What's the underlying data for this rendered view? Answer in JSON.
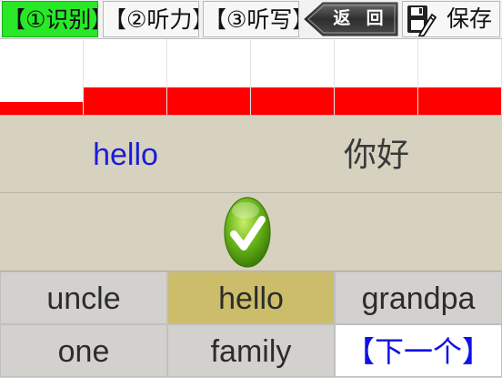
{
  "toolbar": {
    "tabs": [
      {
        "label": "【①识别】",
        "active": true
      },
      {
        "label": "【②听力】",
        "active": false
      },
      {
        "label": "【③听写】",
        "active": false
      }
    ],
    "back_label": "返 回",
    "save_label": "保存"
  },
  "progress": {
    "levels": [
      0.36,
      0.36,
      0.36,
      0.36,
      0.36,
      0.36
    ],
    "first_column_fill": 0.17,
    "fill_color": "#ff0000"
  },
  "word": {
    "english": "hello",
    "chinese": "你好"
  },
  "result": {
    "icon": "check-icon",
    "status": "correct"
  },
  "options": [
    {
      "label": "uncle",
      "highlighted": false
    },
    {
      "label": "hello",
      "highlighted": true
    },
    {
      "label": "grandpa",
      "highlighted": false
    },
    {
      "label": "one",
      "highlighted": false
    },
    {
      "label": "family",
      "highlighted": false
    }
  ],
  "next_label": "【下一个】",
  "colors": {
    "active_tab": "#28e828",
    "highlight_option": "#cbbd6a",
    "english_text": "#1c1cd6",
    "next_text": "#1010e8"
  }
}
